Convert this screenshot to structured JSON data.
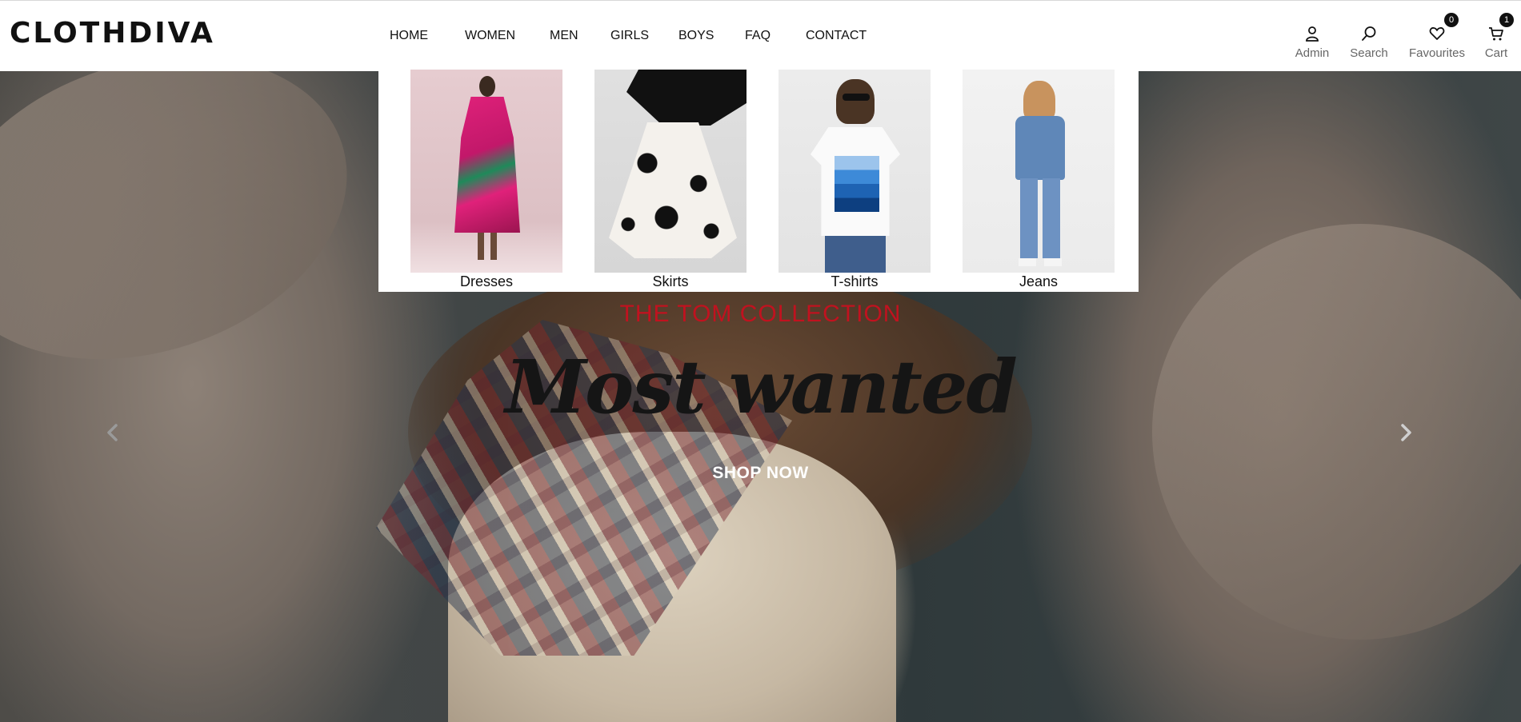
{
  "brand": {
    "logo_text": "CLOTHDIVA"
  },
  "nav": {
    "items": [
      {
        "label": "HOME"
      },
      {
        "label": "WOMEN"
      },
      {
        "label": "MEN"
      },
      {
        "label": "GIRLS"
      },
      {
        "label": "BOYS"
      },
      {
        "label": "FAQ"
      },
      {
        "label": "CONTACT"
      }
    ]
  },
  "tools": {
    "admin": {
      "label": "Admin",
      "icon": "user-icon"
    },
    "search": {
      "label": "Search",
      "icon": "search-icon"
    },
    "favourites": {
      "label": "Favourites",
      "icon": "heart-icon",
      "count": "0"
    },
    "cart": {
      "label": "Cart",
      "icon": "cart-icon",
      "count": "1"
    }
  },
  "dropdown": {
    "categories": [
      {
        "label": "Dresses"
      },
      {
        "label": "Skirts"
      },
      {
        "label": "T-shirts"
      },
      {
        "label": "Jeans"
      }
    ]
  },
  "hero": {
    "collection": "THE TOM COLLECTION",
    "headline": "Most wanted",
    "cta": "SHOP NOW",
    "prev_icon": "chevron-left-icon",
    "next_icon": "chevron-right-icon"
  },
  "colors": {
    "accent": "#c1121f",
    "header_bg": "#ffffff",
    "text": "#111111"
  }
}
